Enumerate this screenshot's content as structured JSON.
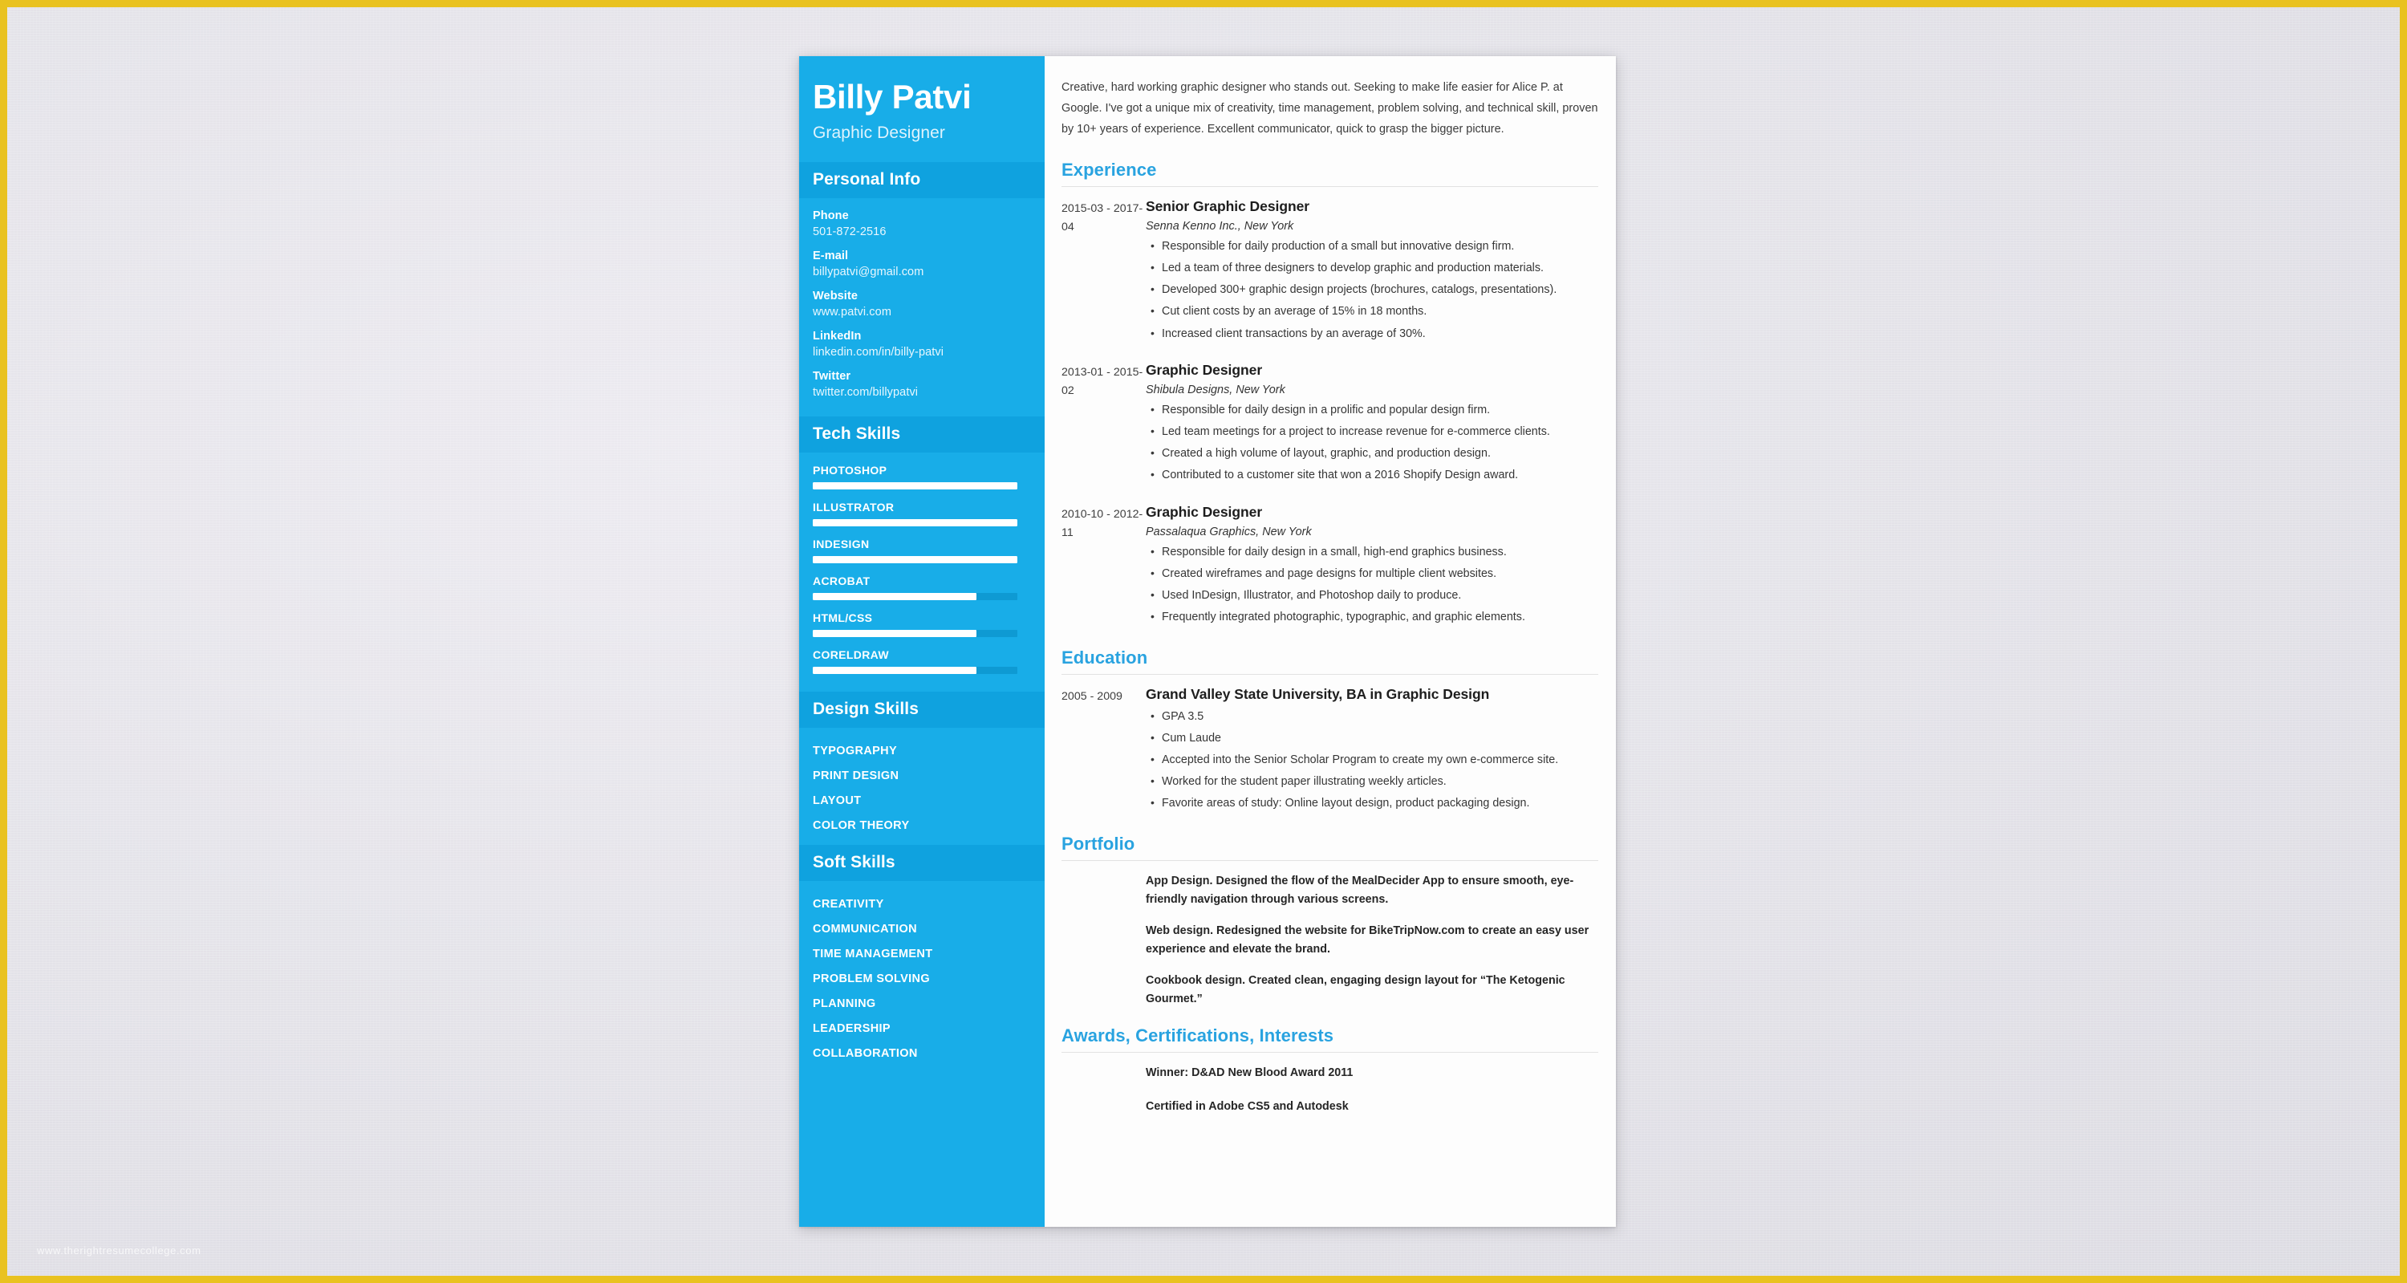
{
  "watermark": "www.therightresumecollege.com",
  "sidebar": {
    "name": "Billy Patvi",
    "role": "Graphic Designer",
    "personal_info": {
      "heading": "Personal Info",
      "items": [
        {
          "label": "Phone",
          "value": "501-872-2516"
        },
        {
          "label": "E-mail",
          "value": "billypatvi@gmail.com"
        },
        {
          "label": "Website",
          "value": "www.patvi.com"
        },
        {
          "label": "LinkedIn",
          "value": "linkedin.com/in/billy-patvi"
        },
        {
          "label": "Twitter",
          "value": "twitter.com/billypatvi"
        }
      ]
    },
    "tech_skills": {
      "heading": "Tech Skills",
      "items": [
        {
          "name": "PHOTOSHOP",
          "level": 100
        },
        {
          "name": "ILLUSTRATOR",
          "level": 100
        },
        {
          "name": "INDESIGN",
          "level": 100
        },
        {
          "name": "ACROBAT",
          "level": 80
        },
        {
          "name": "HTML/CSS",
          "level": 80
        },
        {
          "name": "CORELDRAW",
          "level": 80
        }
      ]
    },
    "design_skills": {
      "heading": "Design Skills",
      "items": [
        "TYPOGRAPHY",
        "PRINT DESIGN",
        "LAYOUT",
        "COLOR THEORY"
      ]
    },
    "soft_skills": {
      "heading": "Soft Skills",
      "items": [
        "CREATIVITY",
        "COMMUNICATION",
        "TIME MANAGEMENT",
        "PROBLEM SOLVING",
        "PLANNING",
        "LEADERSHIP",
        "COLLABORATION"
      ]
    }
  },
  "main": {
    "summary": "Creative, hard working graphic designer who stands out. Seeking to make life easier for Alice P. at Google. I've got a unique mix of creativity, time management, problem solving, and technical skill, proven by 10+ years of experience. Excellent communicator, quick to grasp the bigger picture.",
    "experience": {
      "heading": "Experience",
      "entries": [
        {
          "date": "2015-03 - 2017-04",
          "title": "Senior Graphic Designer",
          "org": "Senna Kenno Inc., New York",
          "bullets": [
            "Responsible for daily production of a small but innovative design firm.",
            "Led a team of three designers to develop graphic and production materials.",
            "Developed 300+ graphic design projects (brochures, catalogs, presentations).",
            "Cut client costs by an average of 15% in 18 months.",
            "Increased client transactions by an average of 30%."
          ]
        },
        {
          "date": "2013-01 - 2015-02",
          "title": "Graphic Designer",
          "org": "Shibula Designs, New York",
          "bullets": [
            "Responsible for daily design in a prolific and popular design firm.",
            "Led team meetings for a project to increase revenue for e-commerce clients.",
            "Created a high volume of layout, graphic, and production design.",
            "Contributed to a customer site that won a 2016 Shopify Design award."
          ]
        },
        {
          "date": "2010-10 - 2012-11",
          "title": "Graphic Designer",
          "org": "Passalaqua Graphics, New York",
          "bullets": [
            "Responsible for daily design in a small, high-end graphics business.",
            "Created wireframes and page designs for multiple client websites.",
            "Used InDesign, Illustrator, and Photoshop daily to produce.",
            "Frequently integrated photographic, typographic, and graphic elements."
          ]
        }
      ]
    },
    "education": {
      "heading": "Education",
      "entries": [
        {
          "date": "2005 - 2009",
          "title": "Grand Valley State University, BA in Graphic Design",
          "bullets": [
            "GPA 3.5",
            "Cum Laude",
            "Accepted into the Senior Scholar Program to create my own e-commerce site.",
            "Worked for the student paper illustrating weekly articles.",
            "Favorite areas of study: Online layout design, product packaging design."
          ]
        }
      ]
    },
    "portfolio": {
      "heading": "Portfolio",
      "entries": [
        "App Design. Designed the flow of the MealDecider App to ensure smooth, eye-friendly navigation through various screens.",
        "Web design. Redesigned the website for BikeTripNow.com to create an easy user experience and elevate the brand.",
        "Cookbook design. Created clean, engaging design layout for “The Ketogenic Gourmet.”"
      ]
    },
    "awards": {
      "heading": "Awards, Certifications, Interests",
      "entries": [
        "Winner: D&AD New Blood Award 2011",
        "Certified in Adobe CS5 and Autodesk"
      ]
    }
  }
}
